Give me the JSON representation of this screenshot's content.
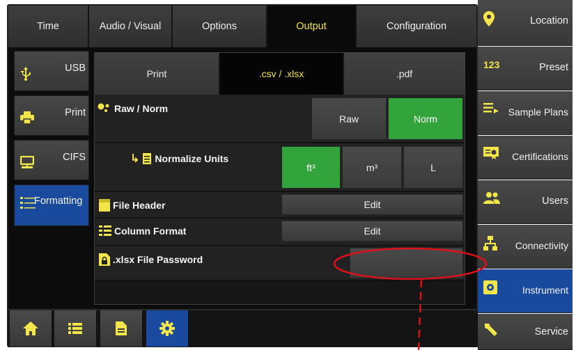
{
  "tabs": [
    "Time",
    "Audio / Visual",
    "Options",
    "Output",
    "Configuration"
  ],
  "side": [
    "USB",
    "Print",
    "CIFS",
    "Formatting"
  ],
  "subtabs": [
    "Print",
    ".csv / .xlsx",
    ".pdf"
  ],
  "rows": {
    "raw_norm": {
      "label": "Raw / Norm",
      "raw": "Raw",
      "norm": "Norm"
    },
    "normalize_units": {
      "label": "Normalize Units",
      "ft3": "ft³",
      "m3": "m³",
      "l": "L"
    },
    "file_header": {
      "label": "File Header",
      "button": "Edit"
    },
    "column_format": {
      "label": "Column Format",
      "button": "Edit"
    },
    "xlsx_password": {
      "label": ".xlsx File Password"
    }
  },
  "right": [
    "Location",
    "Preset",
    "Sample Plans",
    "Certifications",
    "Users",
    "Connectivity",
    "Instrument",
    "Service"
  ],
  "icons": {
    "preset_glyph": "123",
    "accent": "#f2e64a",
    "active_blue": "#1a4a9e",
    "green": "#33a33b",
    "annotation_red": "#e0101a"
  }
}
